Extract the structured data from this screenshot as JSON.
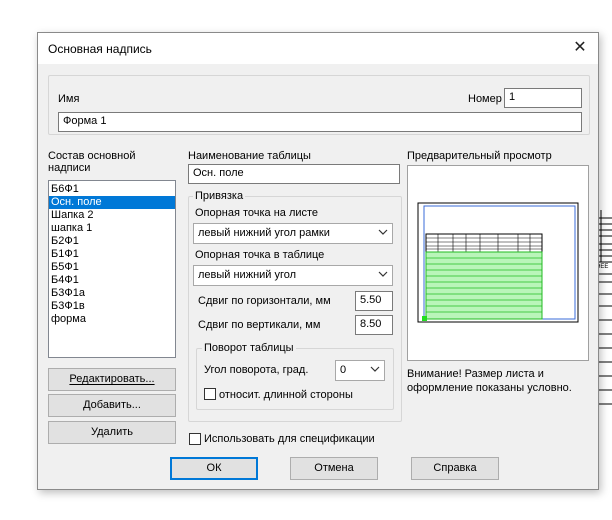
{
  "dialog": {
    "title": "Основная надпись",
    "close_glyph": "✕",
    "name_label": "Имя",
    "name_value": "Форма 1",
    "number_label": "Номер",
    "number_value": "1",
    "composition_label": "Состав основной надписи",
    "composition_items": [
      "Б6Ф1",
      "Осн. поле",
      "Шапка 2",
      "шапка 1",
      "Б2Ф1",
      "Б1Ф1",
      "Б5Ф1",
      "Б4Ф1",
      "Б3Ф1а",
      "Б3Ф1в",
      "форма"
    ],
    "selected_item": "Осн. поле",
    "table_name_label": "Наименование таблицы",
    "table_name_value": "Осн. поле",
    "binding": {
      "group_label": "Привязка",
      "sheet_point_label": "Опорная точка на листе",
      "sheet_point_value": "левый нижний угол рамки",
      "table_point_label": "Опорная точка в таблице",
      "table_point_value": "левый нижний угол",
      "shift_h_label": "Сдвиг по горизонтали, мм",
      "shift_h_value": "5.50",
      "shift_v_label": "Сдвиг по вертикали, мм",
      "shift_v_value": "8.50"
    },
    "rotation": {
      "group_label": "Поворот таблицы",
      "angle_label": "Угол поворота, град.",
      "angle_value": "0",
      "relative_label": "относит. длинной стороны",
      "relative_checked": false
    },
    "preview_label": "Предварительный просмотр",
    "notice": "Внимание! Размер листа и оформление показаны условно.",
    "buttons": {
      "edit": "Редактировать...",
      "add": "Добавить...",
      "delete": "Удалить",
      "ok": "ОК",
      "cancel": "Отмена",
      "help": "Справка"
    },
    "spec_label": "Использовать для спецификации",
    "spec_checked": false,
    "colors": {
      "accent": "#0078d7",
      "preview_fill": "#b9f5b9",
      "preview_lines": "#22bb22"
    }
  },
  "background": {
    "fragment_text": "ЭЕЕ"
  }
}
